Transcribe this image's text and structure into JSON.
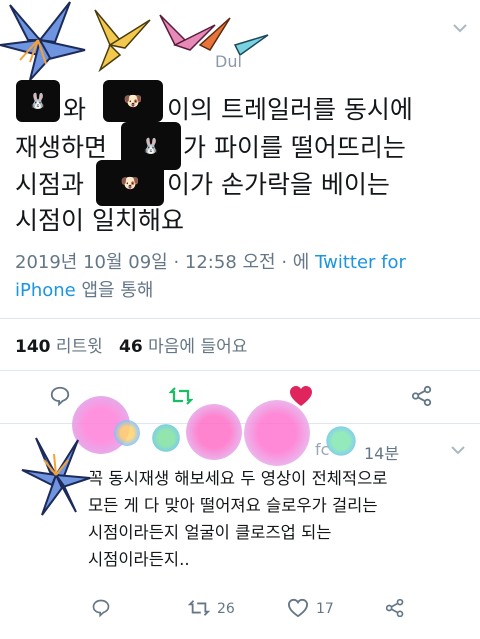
{
  "header": {
    "handle_fragment": "Dul",
    "chevron_icon": "chevron-down-icon"
  },
  "tweet": {
    "line1_a": "와",
    "line1_b": "이의 트레일러를 동시에",
    "line2_a": "재생하면",
    "line2_b": "가 파이를 떨어뜨리는",
    "line3_a": "시점과",
    "line3_b": "이가 손가락을 베이는",
    "line4": "시점이 일치해요",
    "emoji_rabbit": "🐰",
    "emoji_dog": "🐶",
    "timestamp": "2019년 10월 09일 · 12:58 오전 · 에",
    "source_a": "Twitter for",
    "source_b": "iPhone",
    "source_suffix": "앱을 통해",
    "retweet_count": "140",
    "retweet_label": "리트윗",
    "like_count": "46",
    "like_label": "마음에 들어요"
  },
  "reply": {
    "name_fragment": "fc",
    "time": "14분",
    "line1": "꼭 동시재생 해보세요 두 영상이 전체적으로",
    "line2": "모든 게 다 맞아 떨어져요 슬로우가 걸리는",
    "line3": "시점이라든지 얼굴이 클로즈업 되는",
    "line4": "시점이라든지..",
    "retweets": "26",
    "likes": "17"
  },
  "colors": {
    "accent": "#1b95e0",
    "retweet_green": "#17bf63",
    "like_red": "#e0245e",
    "muted": "#657786"
  }
}
